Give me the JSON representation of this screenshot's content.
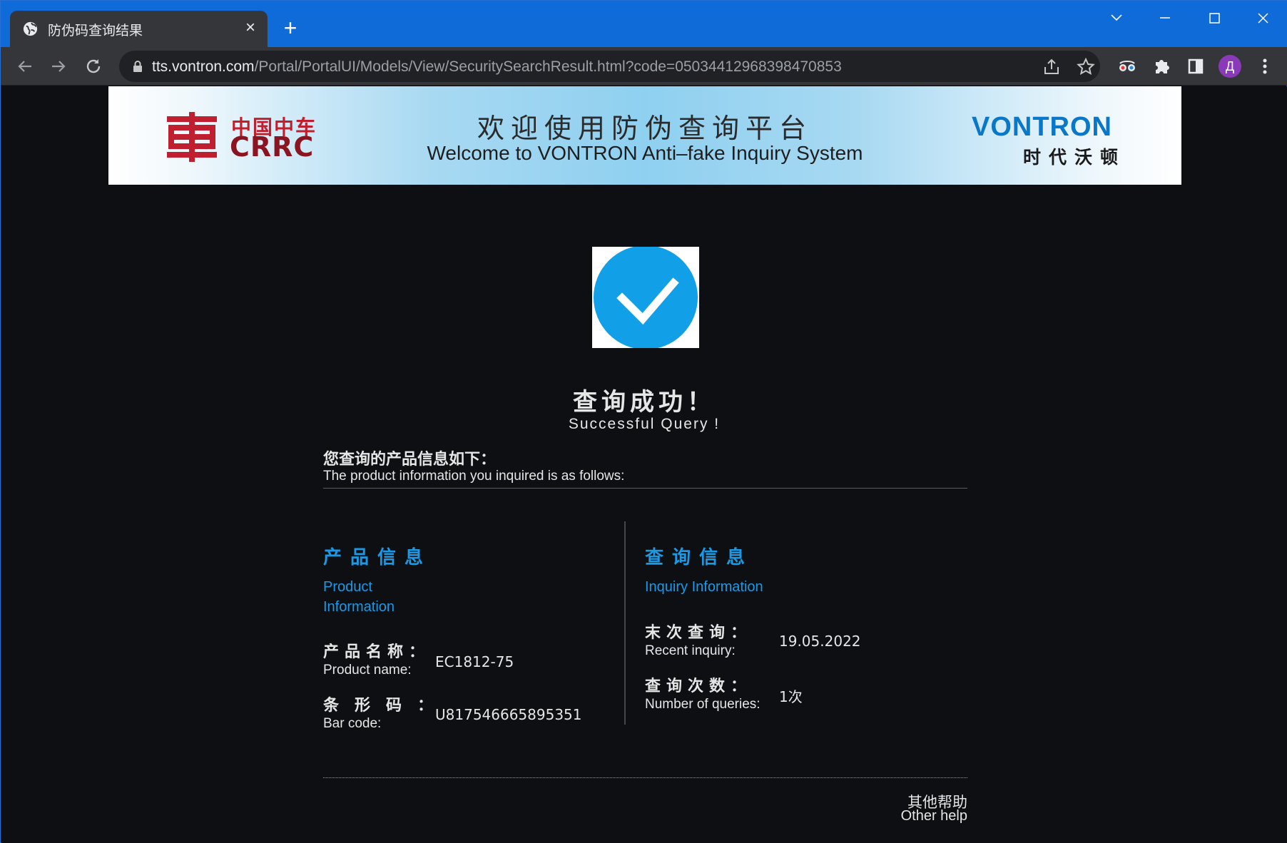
{
  "browser": {
    "tab_title": "防伪码查询结果",
    "url_host": "tts.vontron.com",
    "url_path": "/Portal/PortalUI/Models/View/SecuritySearchResult.html?code=05034412968398470853",
    "profile_initial": "Д",
    "accent_color": "#0f6bd8"
  },
  "banner": {
    "crrc_cn": "中国中车",
    "crrc_en": "CRRC",
    "title_cn": "欢迎使用防伪查询平台",
    "title_en": "Welcome to VONTRON Anti–fake Inquiry System",
    "vontron_en": "VONTRON",
    "vontron_cn": "时代沃顿"
  },
  "result": {
    "status_cn": "查询成功！",
    "status_en": "Successful Query !",
    "check_color": "#11a0e8"
  },
  "intro": {
    "cn": "您查询的产品信息如下：",
    "en": "The product information you inquired is as follows:"
  },
  "product": {
    "title_cn": "产品信息",
    "title_en_1": "Product",
    "title_en_2": "Information",
    "name_label_cn": "产品名称：",
    "name_label_en": "Product name:",
    "name_value": "EC1812-75",
    "barcode_label_cn": "条形码：",
    "barcode_label_en": "Bar code:",
    "barcode_value": "U817546665895351"
  },
  "inquiry": {
    "title_cn": "查询信息",
    "title_en": "Inquiry Information",
    "recent_label_cn": "末次查询：",
    "recent_label_en": "Recent inquiry:",
    "recent_value": "19.05.2022",
    "count_label_cn": "查询次数：",
    "count_label_en": "Number of queries:",
    "count_value": "1次"
  },
  "footer": {
    "help_cn": "其他帮助",
    "help_en": "Other help"
  }
}
